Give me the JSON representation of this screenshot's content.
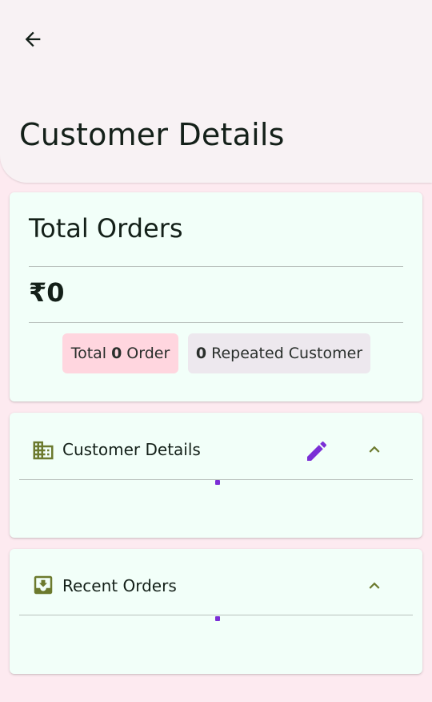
{
  "header": {
    "title": "Customer Details",
    "back_icon": "arrow-back-icon"
  },
  "orders_card": {
    "title": "Total Orders",
    "amount": "₹0",
    "total_chip": {
      "prefix": "Total",
      "count": "0",
      "suffix": "Order"
    },
    "repeat_chip": {
      "count": "0",
      "suffix": "Repeated Customer"
    }
  },
  "customer_section": {
    "label": "Customer Details",
    "icon": "building-icon",
    "edit_icon": "pencil-icon",
    "toggle_icon": "chevron-up-icon",
    "loading": true
  },
  "recent_section": {
    "label": "Recent Orders",
    "icon": "inbox-icon",
    "toggle_icon": "chevron-up-icon",
    "loading": true
  },
  "colors": {
    "background": "#fdeaf0",
    "header": "#f8f2f4",
    "card": "#f2fff9",
    "accent_green": "#6c7a2e",
    "accent_purple": "#7b2fd6",
    "chip_pink": "#ffd6df",
    "chip_gray": "#ede8ee"
  }
}
